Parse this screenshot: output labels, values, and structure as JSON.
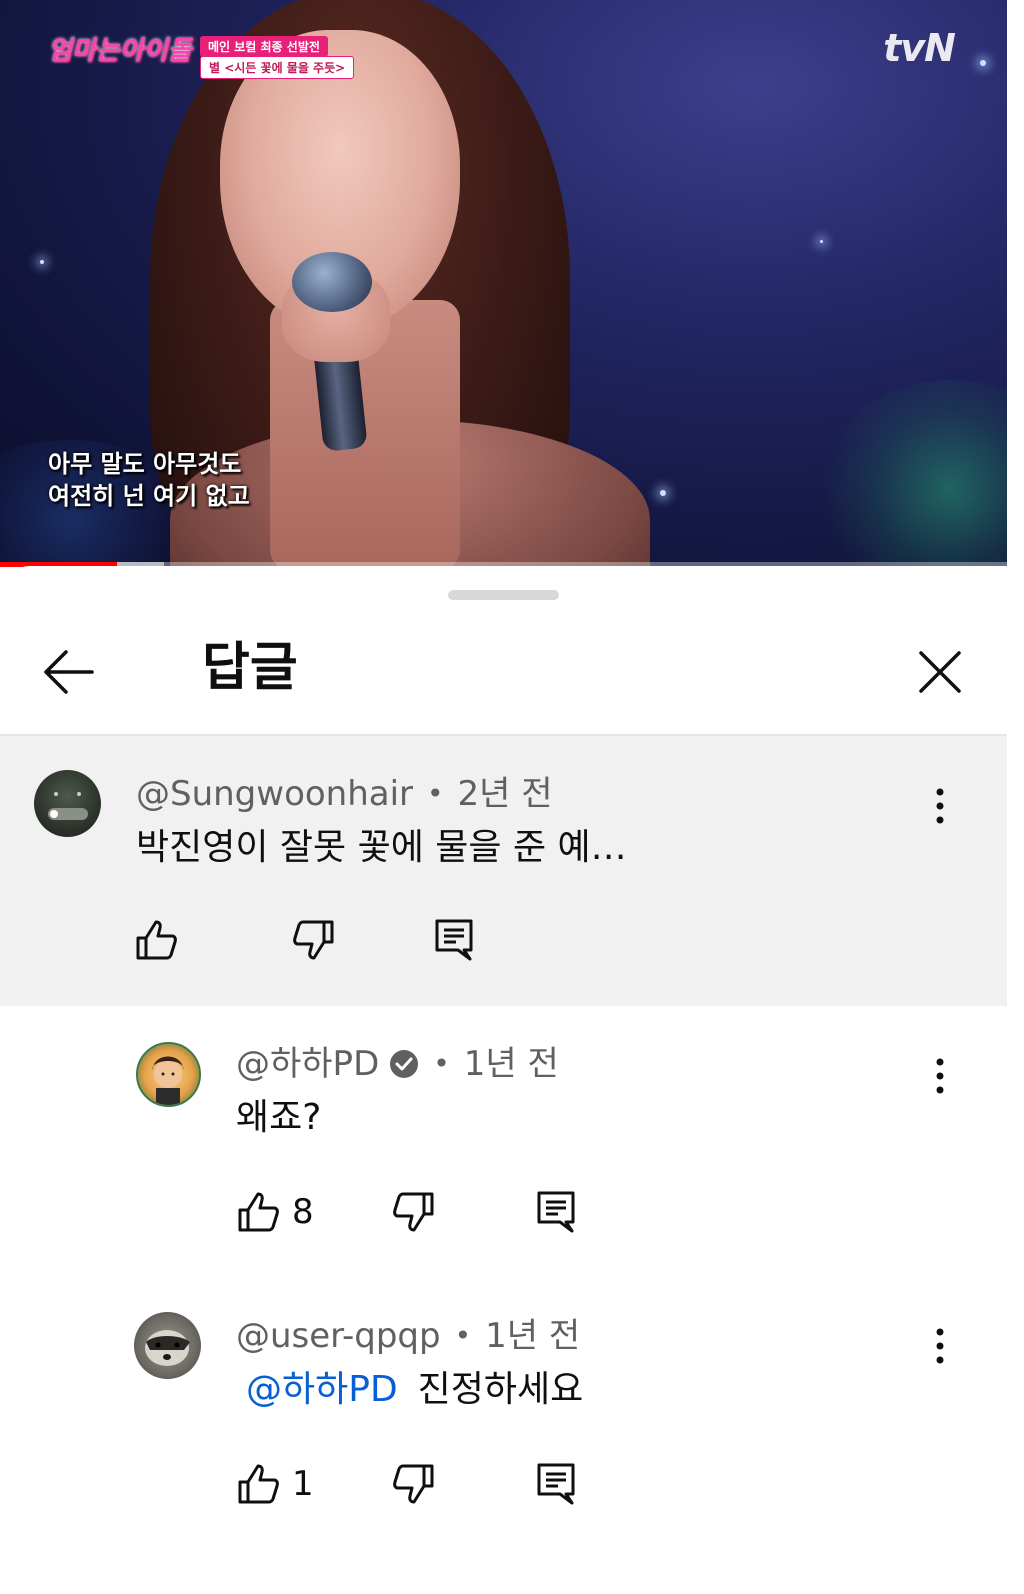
{
  "video": {
    "show_logo": "엄마는아이돌",
    "tag_line1": "메인 보컬 최종 선발전",
    "tag_line2": "별 <시든 꽃에 물을 주듯>",
    "channel_mark": "tvN",
    "subtitle_line1": "아무 말도 아무것도",
    "subtitle_line2": "여전히 넌 여기 없고",
    "progress_played": 0.116,
    "progress_buffered": 0.163
  },
  "sheet": {
    "title": "답글"
  },
  "parent_comment": {
    "author": "@Sungwoonhair",
    "time": "2년 전",
    "text": "박진영이 잘못 꽃에 물을 준 예…"
  },
  "replies": [
    {
      "author": "@하하PD",
      "verified": true,
      "time": "1년 전",
      "text": "왜죠?",
      "likes": "8"
    },
    {
      "author": "@user-qpqp",
      "verified": false,
      "time": "1년 전",
      "mention": "@하하PD",
      "text": "진정하세요",
      "likes": "1"
    }
  ],
  "colors": {
    "accent_red": "#ff0000",
    "link_blue": "#065fd4",
    "parent_bg": "#f1f1f1"
  }
}
